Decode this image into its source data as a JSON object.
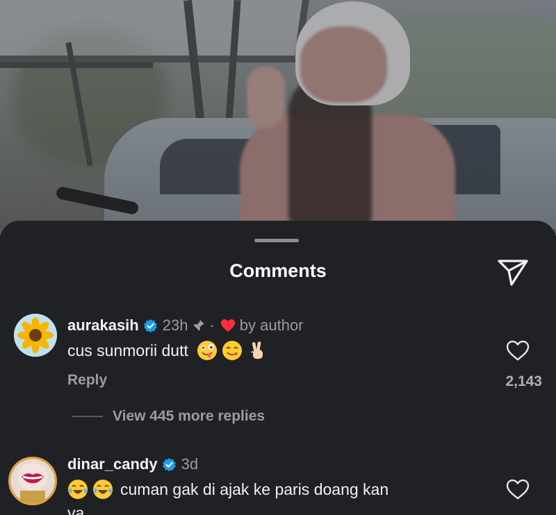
{
  "sheet": {
    "title": "Comments",
    "share_icon": "paper-plane-icon"
  },
  "comments": [
    {
      "username": "aurakasih",
      "verified": true,
      "time": "23h",
      "pinned": true,
      "separator": "·",
      "liked_by_author_label": "by author",
      "text": "cus sunmorii dutt",
      "emojis": [
        "zany-face-emoji",
        "yum-face-emoji",
        "peace-hand-emoji"
      ],
      "reply_label": "Reply",
      "like_count": "2,143",
      "view_replies_label": "View 445 more replies",
      "avatar": "sunflower-avatar"
    },
    {
      "username": "dinar_candy",
      "verified": true,
      "time": "3d",
      "text": "cuman gak di ajak ke paris doang kan",
      "text_overflow": "ya",
      "lead_emojis": [
        "tears-of-joy-emoji",
        "tears-of-joy-emoji"
      ],
      "avatar": "lips-avatar"
    }
  ],
  "colors": {
    "sheet_bg": "#202124",
    "verified_blue": "#1d9bf0",
    "heart_red": "#ff2d3d",
    "muted_text": "#9c9ca2"
  }
}
